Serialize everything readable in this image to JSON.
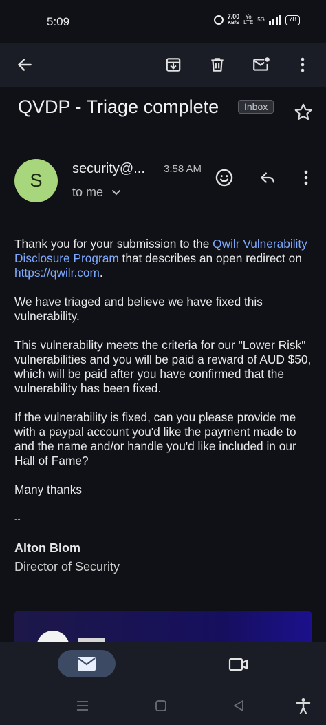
{
  "status_bar": {
    "time": "5:09",
    "speed_value": "7.00",
    "speed_unit": "KB/S",
    "net_top": "Yo",
    "net_bottom": "LTE",
    "net_5g": "5G",
    "battery": "78"
  },
  "toolbar": {
    "icons": [
      "back-arrow-icon",
      "archive-icon",
      "delete-icon",
      "mark-unread-icon",
      "more-vert-icon"
    ]
  },
  "email": {
    "subject": "QVDP - Triage complete",
    "label": "Inbox",
    "sender": "security@...",
    "time": "3:58 AM",
    "recipient": "to me",
    "avatar_letter": "S",
    "avatar_color": "#a7d67d",
    "body": {
      "p1_start": "Thank you for your submission to the ",
      "p1_link": "Qwilr Vulnerability Disclosure Program",
      "p1_mid": " that describes an open redirect on ",
      "p1_url": "https://qwilr.com",
      "p1_end": ".",
      "p2": "We have triaged and believe we have fixed this vulnerability.",
      "p3": "This vulnerability meets the criteria for our \"Lower Risk\" vulnerabilities and you will be paid a reward of AUD $50, which will be paid after you have confirmed that the vulnerability has been fixed.",
      "p4": "If the vulnerability is fixed, can you please provide me with a paypal account you'd like the payment made to and the name and/or handle you'd like included in our Hall of Fame?",
      "p5": "Many thanks",
      "separator": "--",
      "signature_name": "Alton Blom",
      "signature_title": "Director of Security"
    }
  },
  "colors": {
    "background": "#0f1116",
    "toolbar": "#1a1d25",
    "link": "#7fa9ff",
    "nav_active": "#3c4b63"
  }
}
